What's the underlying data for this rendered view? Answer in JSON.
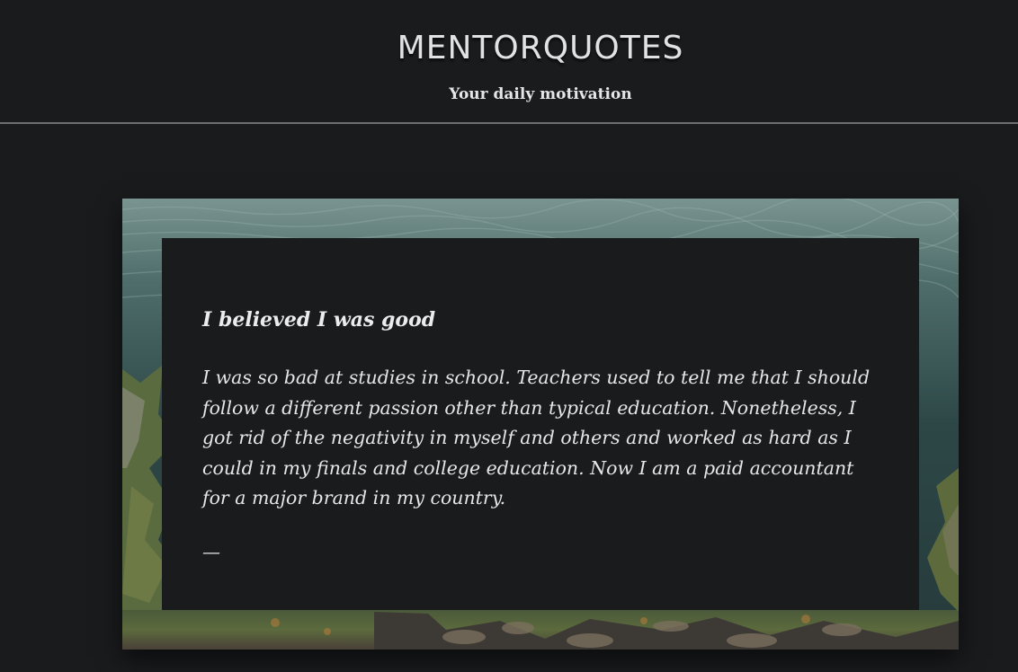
{
  "header": {
    "title": "MENTORQUOTES",
    "tagline": "Your daily motivation"
  },
  "quote": {
    "title": "I believed I was good",
    "body": "I was so bad at studies in school. Teachers used to tell me that I should follow a different passion other than typical education. Nonetheless, I got rid of the negativity in myself and others and worked as hard as I could in my finals and college education. Now I am a paid accountant for a major brand in my country.",
    "author": "—"
  },
  "colors": {
    "background": "#1a1b1d",
    "text": "#e4e4e4",
    "divider": "#6e6f71"
  }
}
